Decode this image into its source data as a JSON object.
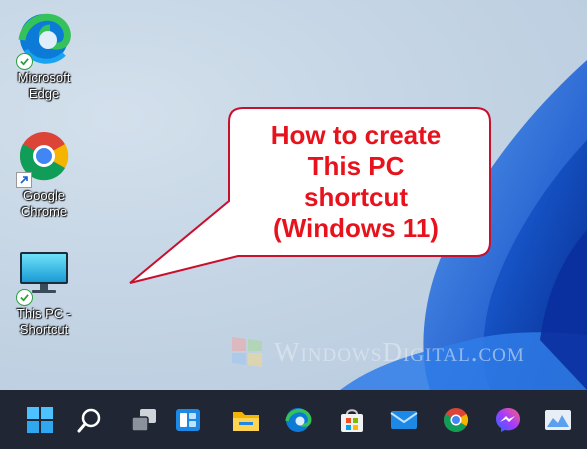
{
  "desktop": {
    "icons": [
      {
        "label_line1": "Microsoft",
        "label_line2": "Edge",
        "icon": "edge-icon"
      },
      {
        "label_line1": "Google",
        "label_line2": "Chrome",
        "icon": "chrome-icon"
      },
      {
        "label_line1": "This PC -",
        "label_line2": "Shortcut",
        "icon": "monitor-icon"
      }
    ]
  },
  "callout": {
    "lines": [
      "How to create",
      "This PC",
      "shortcut",
      "(Windows 11)"
    ],
    "color": "#e8121c"
  },
  "watermark": {
    "text": "WindowsDigital.com"
  },
  "taskbar": {
    "background": "#202634",
    "items": [
      "start-icon",
      "search-icon",
      "task-view-icon",
      "widgets-icon",
      "file-explorer-icon",
      "edge-icon",
      "microsoft-store-icon",
      "mail-icon",
      "chrome-icon",
      "messenger-icon",
      "photos-icon"
    ]
  }
}
